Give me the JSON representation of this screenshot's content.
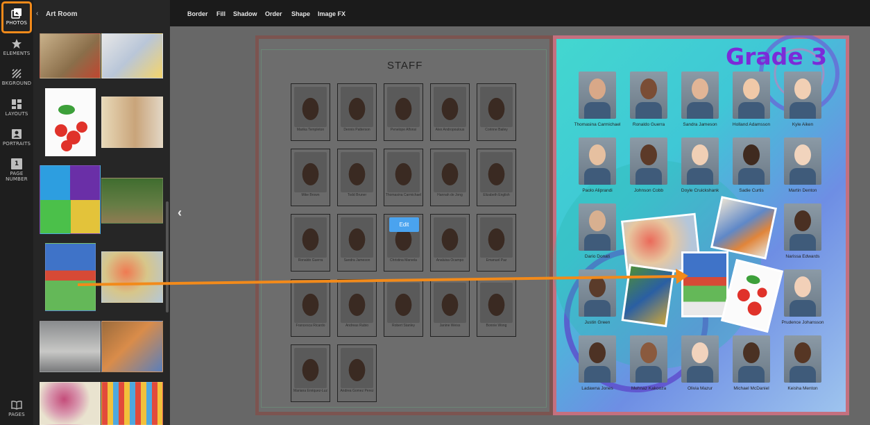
{
  "rail": {
    "items": [
      {
        "label": "PHOTOS",
        "icon": "photos-icon"
      },
      {
        "label": "ELEMENTS",
        "icon": "star-icon"
      },
      {
        "label": "BKGROUND",
        "icon": "background-icon"
      },
      {
        "label": "LAYOUTS",
        "icon": "layouts-icon"
      },
      {
        "label": "PORTRAITS",
        "icon": "portraits-icon"
      },
      {
        "label": "PAGE NUMBER",
        "icon": "page-number-icon"
      },
      {
        "label": "PAGES",
        "icon": "pages-icon"
      }
    ],
    "page_number_glyph": "1"
  },
  "panel": {
    "back_glyph": "‹",
    "title": "Art Room"
  },
  "toolbar": {
    "items": [
      "Border",
      "Fill",
      "Shadow",
      "Order",
      "Shape",
      "Image FX"
    ]
  },
  "canvas": {
    "nav_prev_glyph": "‹",
    "edit_label": "Edit"
  },
  "staff": {
    "title": "STAFF",
    "members": [
      "Marika Templeton",
      "Dennis Patterson",
      "Penelope Alfonsi",
      "Alex Andropoulous",
      "Corinne Bailey",
      "Mike Brown",
      "Todd Bruner",
      "Thomasina Carmichael",
      "Hannah de Jong",
      "Elizabeth English",
      "Ronaldo Guerra",
      "Sandra Jameson",
      "Christina Marvela",
      "Analuisa Ocampo",
      "Emanuel Paz",
      "Francesca Ricardo",
      "Andreas Rubio",
      "Robert Stanley",
      "Janine Weiss",
      "Bonnie Wong",
      "Mariana Enriquez-Luz",
      "Andrea Gomez Perez"
    ]
  },
  "grade": {
    "title": "Grade 3",
    "students": [
      "Thomasina Carmichael",
      "Ronaldo Guerra",
      "Sandra Jameson",
      "Holland Adamsson",
      "Kyle Aiken",
      "Paolo Aliprandi",
      "Johnson Cobb",
      "Doyle Cruickshank",
      "Sadie Curtis",
      "Martin Denton",
      "Dario Donati",
      "Narissa Edwards",
      "Justin Green",
      "Prudence Johansson",
      "Ladawna Jones",
      "Mehnaz Kakooza",
      "Olivia Mazur",
      "Michael McDaniel",
      "Keisha Menton"
    ]
  },
  "colors": {
    "accent": "#f28a1a",
    "edit": "#4aa3ef",
    "grade_title": "#7b2bd8"
  }
}
